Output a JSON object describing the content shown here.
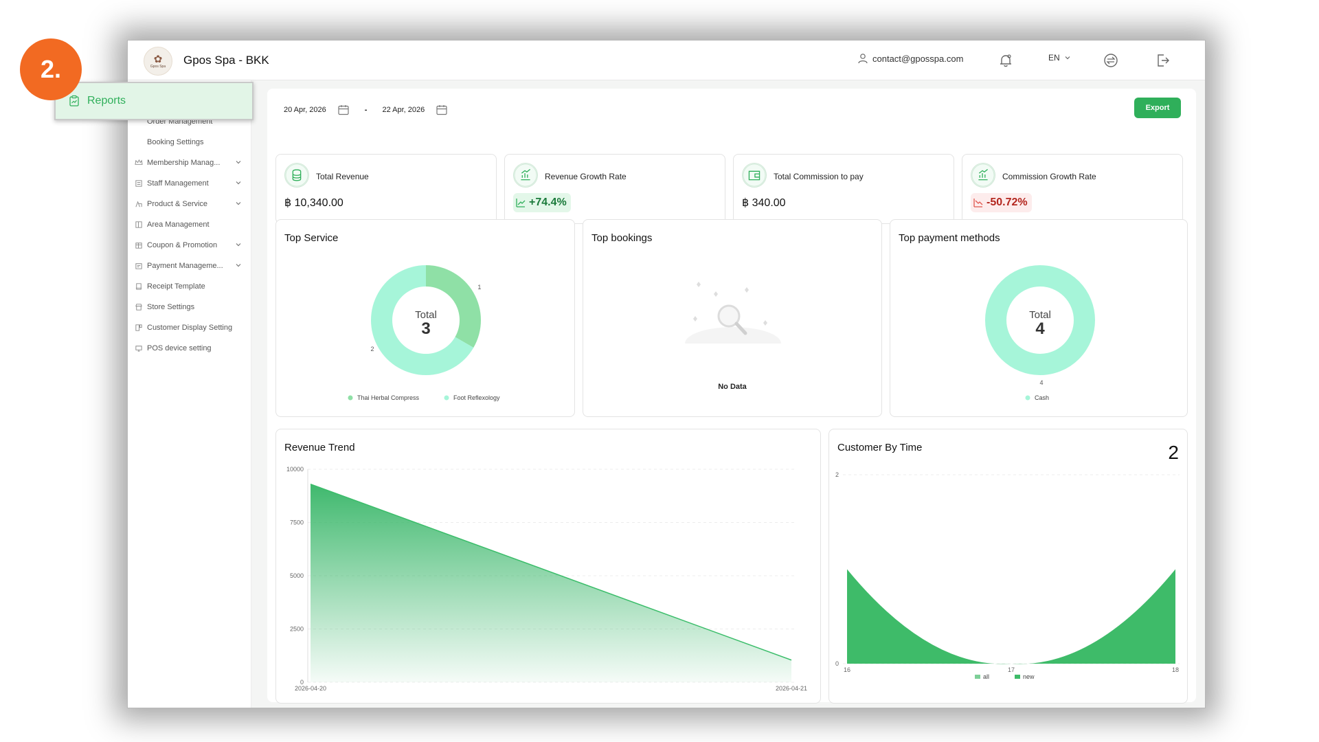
{
  "step_badge": "2.",
  "callout_label": "Reports",
  "header": {
    "brand": "Gpos Spa - BKK",
    "logo_text": "Gpos Spa",
    "email": "contact@gposspa.com",
    "language": "EN"
  },
  "sidebar": {
    "items": [
      {
        "label": "Order Management",
        "icon": "none",
        "expandable": false
      },
      {
        "label": "Booking Settings",
        "icon": "none",
        "expandable": false
      },
      {
        "label": "Membership Manag...",
        "icon": "crown-icon",
        "expandable": true
      },
      {
        "label": "Staff Management",
        "icon": "staff-icon",
        "expandable": true
      },
      {
        "label": "Product & Service",
        "icon": "product-icon",
        "expandable": true
      },
      {
        "label": "Area Management",
        "icon": "area-icon",
        "expandable": false
      },
      {
        "label": "Coupon & Promotion",
        "icon": "coupon-icon",
        "expandable": true
      },
      {
        "label": "Payment Manageme...",
        "icon": "payment-icon",
        "expandable": true
      },
      {
        "label": "Receipt Template",
        "icon": "receipt-icon",
        "expandable": false
      },
      {
        "label": "Store Settings",
        "icon": "store-icon",
        "expandable": false
      },
      {
        "label": "Customer Display Setting",
        "icon": "display-icon",
        "expandable": false
      },
      {
        "label": "POS device setting",
        "icon": "pos-icon",
        "expandable": false
      }
    ]
  },
  "filters": {
    "date_from": "20 Apr, 2026",
    "date_to": "22 Apr, 2026",
    "separator": "-",
    "export_label": "Export"
  },
  "kpis": [
    {
      "label": "Total Revenue",
      "value": "฿ 10,340.00",
      "icon": "coins-icon",
      "type": "value"
    },
    {
      "label": "Revenue Growth Rate",
      "value": "+74.4%",
      "icon": "growth-chart-icon",
      "type": "up"
    },
    {
      "label": "Total Commission to pay",
      "value": "฿ 340.00",
      "icon": "wallet-icon",
      "type": "value"
    },
    {
      "label": "Commission Growth Rate",
      "value": "-50.72%",
      "icon": "growth-chart-icon",
      "type": "down"
    }
  ],
  "cards": {
    "top_service": "Top Service",
    "top_bookings": "Top bookings",
    "top_payment": "Top payment methods",
    "no_data": "No Data",
    "revenue_trend": "Revenue Trend",
    "customer_by_time": "Customer By Time",
    "customer_total": "2"
  },
  "colors": {
    "accent": "#2faf5a",
    "donut_light": "#a6f5d9",
    "donut_dark": "#8fe0a6",
    "area_dark": "#35b566",
    "step_badge": "#f26a22"
  },
  "chart_data": [
    {
      "type": "pie",
      "title": "Top Service",
      "center_label": "Total",
      "center_value": "3",
      "slices": [
        {
          "label": "Thai Herbal Compress",
          "value": 1
        },
        {
          "label": "Foot Reflexology",
          "value": 2
        }
      ],
      "legend": "bottom"
    },
    {
      "type": "pie",
      "title": "Top payment methods",
      "center_label": "Total",
      "center_value": "4",
      "slices": [
        {
          "label": "Cash",
          "value": 4
        }
      ],
      "legend": "bottom"
    },
    {
      "type": "area",
      "title": "Revenue Trend",
      "x": [
        "2026-04-20",
        "2026-04-21"
      ],
      "values": [
        9300,
        1040
      ],
      "ylim": [
        0,
        10000
      ],
      "yticks": [
        "0",
        "2500",
        "5000",
        "7500",
        "10000"
      ],
      "grid": true
    },
    {
      "type": "area",
      "title": "Customer By Time",
      "x": [
        "16",
        "17",
        "18"
      ],
      "series": [
        {
          "name": "all",
          "values": [
            1,
            0,
            1
          ]
        },
        {
          "name": "new",
          "values": [
            1,
            0,
            1
          ]
        }
      ],
      "ylim": [
        0,
        2
      ],
      "yticks": [
        "0",
        "2"
      ],
      "legend": "bottom",
      "grid": true
    }
  ]
}
